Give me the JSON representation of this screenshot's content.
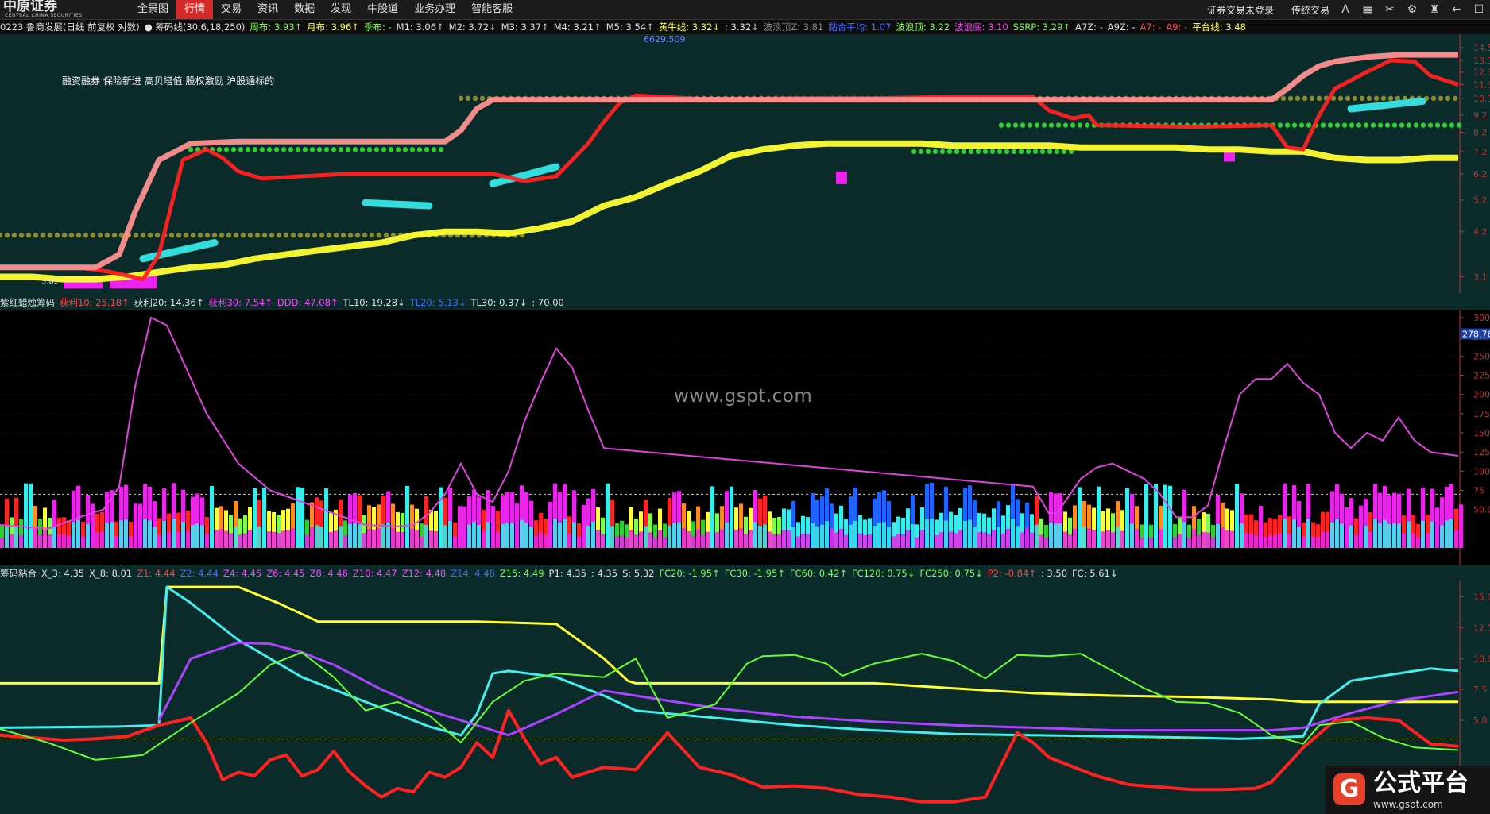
{
  "app": {
    "logo_text": "中原证券",
    "logo_sub": "CENTRAL CHINA SECURITIES",
    "menu": [
      "全景图",
      "行情",
      "交易",
      "资讯",
      "数据",
      "发现",
      "牛股道",
      "业务办理",
      "智能客服"
    ],
    "active_menu": "行情",
    "right_menu": [
      "证券交易未登录",
      "传统交易"
    ],
    "icons": [
      "font-size-icon",
      "grid-icon",
      "tools-icon",
      "gear-icon",
      "shirt-icon",
      "back-arrow-icon",
      "chat-icon"
    ]
  },
  "panel1": {
    "legend": [
      {
        "text": "0223 鲁商发展(日线 前复权 对数)",
        "color": "#e0e0e0"
      },
      {
        "text": "● 筹码线(30,6,18,250)",
        "color": "#e0e0e0"
      },
      {
        "text": "周布: 3.93↑",
        "color": "#7cff4c"
      },
      {
        "text": "月布: 3.96↑",
        "color": "#ffff44"
      },
      {
        "text": "季布: -",
        "color": "#7cff4c"
      },
      {
        "text": "M1: 3.06↑",
        "color": "#e0e0e0"
      },
      {
        "text": "M2: 3.72↓",
        "color": "#e0e0e0"
      },
      {
        "text": "M3: 3.37↑",
        "color": "#e0e0e0"
      },
      {
        "text": "M4: 3.21↑",
        "color": "#e0e0e0"
      },
      {
        "text": "M5: 3.54↑",
        "color": "#e0e0e0"
      },
      {
        "text": "黄牛线: 3.32↓",
        "color": "#ffff44"
      },
      {
        "text": ": 3.32↓",
        "color": "#e0e0e0"
      },
      {
        "text": "波浪顶Z: 3.81",
        "color": "#8a8a8a"
      },
      {
        "text": "黏合平均: 1.07",
        "color": "#4a6bff"
      },
      {
        "text": "波浪顶: 3.22",
        "color": "#7cff4c"
      },
      {
        "text": "波浪底: 3.10",
        "color": "#ff44ff"
      },
      {
        "text": "SSRP: 3.29↑",
        "color": "#7cff4c"
      },
      {
        "text": "A7Z: -",
        "color": "#e0e0e0"
      },
      {
        "text": "A9Z: -",
        "color": "#e0e0e0"
      },
      {
        "text": "A7: -",
        "color": "#ff4444"
      },
      {
        "text": "A9: -",
        "color": "#ff4444"
      },
      {
        "text": "平台线: 3.48",
        "color": "#ffff44"
      }
    ],
    "annotation": "融资融券 保险新进 高贝塔值 股权激励 沪股通标的",
    "peak_label": "6629.509",
    "price_label": "3.02",
    "chart_data": {
      "type": "line",
      "scale": "log",
      "y_ticks": [
        "14.5",
        "13.3",
        "12.3",
        "11.3",
        "10.3",
        "9.2",
        "8.2",
        "7.2",
        "6.2",
        "5.2",
        "4.2",
        "3.1"
      ],
      "series": [
        {
          "color": "#ffff33",
          "x": [
            0,
            40,
            80,
            120,
            160,
            200,
            240,
            280,
            320,
            360,
            400,
            440,
            480,
            520,
            560,
            600,
            640,
            680,
            720,
            760,
            800,
            840,
            880,
            920,
            960,
            1000,
            1040,
            1080,
            1120,
            1160,
            1200,
            1240,
            1280,
            1320,
            1360,
            1400,
            1440,
            1480,
            1520,
            1560,
            1600,
            1640,
            1680,
            1720,
            1760,
            1800,
            1835
          ],
          "y": [
            3.1,
            3.1,
            3.05,
            3.05,
            3.1,
            3.2,
            3.3,
            3.35,
            3.5,
            3.6,
            3.7,
            3.8,
            3.9,
            4.1,
            4.2,
            4.2,
            4.15,
            4.3,
            4.5,
            5.0,
            5.3,
            5.8,
            6.3,
            7.0,
            7.3,
            7.5,
            7.6,
            7.6,
            7.6,
            7.6,
            7.5,
            7.5,
            7.5,
            7.5,
            7.4,
            7.4,
            7.4,
            7.4,
            7.3,
            7.3,
            7.2,
            7.2,
            6.9,
            6.8,
            6.8,
            6.9,
            6.9
          ]
        },
        {
          "color": "#ff2222",
          "x": [
            100,
            140,
            180,
            200,
            230,
            260,
            280,
            300,
            330,
            380,
            440,
            500,
            540,
            580,
            620,
            660,
            700,
            720,
            740,
            760,
            780,
            800,
            900,
            1000,
            1100,
            1200,
            1300,
            1320,
            1350,
            1370,
            1380,
            1500,
            1600,
            1620,
            1640,
            1660,
            1680,
            1720,
            1750,
            1780,
            1800,
            1835
          ],
          "y": [
            3.3,
            3.2,
            3.05,
            3.6,
            6.8,
            7.3,
            6.9,
            6.3,
            6.0,
            6.1,
            6.2,
            6.2,
            6.2,
            6.2,
            6.2,
            5.9,
            6.1,
            6.8,
            7.6,
            8.8,
            10.0,
            10.5,
            10.2,
            10.3,
            10.3,
            10.4,
            10.4,
            9.5,
            9.0,
            9.2,
            8.6,
            8.5,
            8.6,
            7.4,
            7.3,
            9.2,
            11.0,
            12.3,
            13.3,
            13.2,
            12.0,
            11.3
          ]
        },
        {
          "color": "#ff9090",
          "x": [
            0,
            60,
            120,
            150,
            170,
            200,
            240,
            300,
            400,
            500,
            560,
            580,
            600,
            620,
            700,
            720,
            760,
            900,
            1100,
            1300,
            1400,
            1500,
            1600,
            1620,
            1640,
            1660,
            1680,
            1720,
            1760,
            1835
          ],
          "y": [
            3.3,
            3.3,
            3.3,
            3.6,
            4.8,
            6.8,
            7.6,
            7.7,
            7.7,
            7.7,
            7.7,
            8.3,
            9.6,
            10.2,
            10.2,
            10.2,
            10.2,
            10.2,
            10.2,
            10.2,
            10.2,
            10.2,
            10.2,
            11.0,
            12.0,
            12.8,
            13.2,
            13.6,
            13.8,
            13.8
          ]
        }
      ]
    }
  },
  "panel2": {
    "legend": [
      {
        "text": "紫红蜡烛筹码",
        "color": "#e0e0e0"
      },
      {
        "text": "获利10: 25.18↑",
        "color": "#ff4444"
      },
      {
        "text": "获利20: 14.36↑",
        "color": "#e0e0e0"
      },
      {
        "text": "获利30: 7.54↑",
        "color": "#ff44ff"
      },
      {
        "text": "DDD: 47.08↑",
        "color": "#ff44ff"
      },
      {
        "text": "TL10: 19.28↓",
        "color": "#e0e0e0"
      },
      {
        "text": "TL20: 5.13↓",
        "color": "#4a6bff"
      },
      {
        "text": "TL30: 0.37↓",
        "color": "#e0e0e0"
      },
      {
        "text": ": 70.00",
        "color": "#e0e0e0"
      }
    ],
    "watermark": "www.gspt.com",
    "current_value": "278.76",
    "chart_data": {
      "type": "bar",
      "y_ticks": [
        "300",
        "275",
        "250",
        "225",
        "200",
        "175",
        "150",
        "125",
        "100",
        "75",
        "50.00"
      ],
      "ylim": [
        0,
        300
      ],
      "reference_line": 70,
      "series": [
        {
          "name": "",
          "color": "#dd44dd",
          "x": [
            0,
            60,
            100,
            130,
            150,
            170,
            190,
            210,
            260,
            300,
            340,
            380,
            420,
            460,
            500,
            520,
            540,
            560,
            580,
            600,
            620,
            640,
            660,
            680,
            700,
            720,
            740,
            760,
            1300,
            1320,
            1330,
            1340,
            1360,
            1380,
            1400,
            1420,
            1440,
            1460,
            1480,
            1500,
            1520,
            1540,
            1560,
            1580,
            1600,
            1620,
            1640,
            1660,
            1680,
            1700,
            1720,
            1740,
            1760,
            1780,
            1800,
            1835
          ],
          "y": [
            30,
            25,
            40,
            50,
            80,
            210,
            300,
            290,
            175,
            110,
            75,
            60,
            45,
            30,
            28,
            30,
            45,
            70,
            110,
            70,
            60,
            100,
            165,
            215,
            260,
            235,
            180,
            130,
            80,
            45,
            45,
            60,
            90,
            105,
            110,
            100,
            90,
            70,
            40,
            40,
            55,
            130,
            200,
            220,
            220,
            240,
            215,
            200,
            150,
            130,
            150,
            140,
            170,
            140,
            125,
            120
          ]
        }
      ]
    }
  },
  "panel3": {
    "legend": [
      {
        "text": "筹码粘合",
        "color": "#e0e0e0"
      },
      {
        "text": "X_3: 4.35",
        "color": "#e0e0e0"
      },
      {
        "text": "X_8: 8.01",
        "color": "#e0e0e0"
      },
      {
        "text": "Z1: 4.44",
        "color": "#ff4444"
      },
      {
        "text": "Z2: 4.44",
        "color": "#4a6bff"
      },
      {
        "text": "Z4: 4.45",
        "color": "#ff44ff"
      },
      {
        "text": "Z6: 4.45",
        "color": "#ff44ff"
      },
      {
        "text": "Z8: 4.46",
        "color": "#ff44ff"
      },
      {
        "text": "Z10: 4.47",
        "color": "#ff44ff"
      },
      {
        "text": "Z12: 4.48",
        "color": "#ff44ff"
      },
      {
        "text": "Z14: 4.48",
        "color": "#4a6bff"
      },
      {
        "text": "Z15: 4.49",
        "color": "#7cff4c"
      },
      {
        "text": "P1: 4.35",
        "color": "#e0e0e0"
      },
      {
        "text": ": 4.35",
        "color": "#e0e0e0"
      },
      {
        "text": "S: 5.32",
        "color": "#e0e0e0"
      },
      {
        "text": "FC20: -1.95↑",
        "color": "#7cff4c"
      },
      {
        "text": "FC30: -1.95↑",
        "color": "#7cff4c"
      },
      {
        "text": "FC60: 0.42↑",
        "color": "#7cff4c"
      },
      {
        "text": "FC120: 0.75↓",
        "color": "#7cff4c"
      },
      {
        "text": "FC250: 0.75↓",
        "color": "#7cff4c"
      },
      {
        "text": "P2: -0.84↑",
        "color": "#ff4444"
      },
      {
        "text": ": 3.50",
        "color": "#e0e0e0"
      },
      {
        "text": "FC: 5.61↓",
        "color": "#e0e0e0"
      }
    ],
    "chart_data": {
      "type": "line",
      "y_ticks": [
        "15.0",
        "12.5",
        "10.0",
        "7.5",
        "5.0"
      ],
      "ylim": [
        -2,
        16
      ],
      "reference_line": 3.5,
      "series": [
        {
          "name": "",
          "color": "#ffff33",
          "x": [
            0,
            200,
            210,
            300,
            350,
            400,
            500,
            600,
            700,
            760,
            790,
            800,
            900,
            1100,
            1200,
            1300,
            1400,
            1500,
            1600,
            1640,
            1700,
            1800,
            1835
          ],
          "y": [
            8.0,
            8.0,
            15.8,
            15.8,
            14.5,
            13.0,
            13.0,
            13.0,
            12.8,
            10.0,
            8.2,
            8.0,
            8.0,
            8.0,
            7.6,
            7.2,
            7.0,
            6.9,
            6.7,
            6.5,
            6.5,
            6.5,
            6.5
          ]
        },
        {
          "name": "",
          "color": "#44eeee",
          "x": [
            0,
            150,
            200,
            210,
            240,
            300,
            380,
            460,
            540,
            580,
            600,
            620,
            640,
            700,
            760,
            800,
            900,
            1000,
            1100,
            1200,
            1300,
            1400,
            1500,
            1560,
            1600,
            1640,
            1660,
            1700,
            1760,
            1800,
            1835
          ],
          "y": [
            4.4,
            4.5,
            4.6,
            15.8,
            14.5,
            11.5,
            8.5,
            6.5,
            4.5,
            3.8,
            5.5,
            8.8,
            9.0,
            8.5,
            7.0,
            5.8,
            5.2,
            4.6,
            4.2,
            3.9,
            3.8,
            3.7,
            3.6,
            3.5,
            3.6,
            3.7,
            6.3,
            8.2,
            8.8,
            9.2,
            9.0
          ]
        },
        {
          "name": "",
          "color": "#ff2222",
          "x": [
            0,
            40,
            80,
            120,
            160,
            200,
            240,
            260,
            280,
            300,
            320,
            340,
            360,
            380,
            400,
            420,
            440,
            460,
            480,
            500,
            520,
            540,
            560,
            580,
            600,
            620,
            640,
            660,
            680,
            700,
            720,
            760,
            800,
            840,
            880,
            920,
            960,
            1000,
            1040,
            1080,
            1120,
            1160,
            1200,
            1240,
            1280,
            1300,
            1320,
            1340,
            1380,
            1420,
            1460,
            1500,
            1540,
            1580,
            1600,
            1640,
            1680,
            1720,
            1760,
            1800,
            1835
          ],
          "y": [
            3.8,
            3.6,
            3.4,
            3.5,
            3.7,
            4.6,
            5.2,
            3.2,
            0.2,
            0.8,
            0.5,
            1.8,
            2.2,
            0.5,
            1.0,
            2.5,
            0.8,
            -0.3,
            -1.2,
            -0.5,
            -0.8,
            0.8,
            0.4,
            1.2,
            3.2,
            2.0,
            5.8,
            3.5,
            1.5,
            2.0,
            0.4,
            1.2,
            1.0,
            4.0,
            1.2,
            0.6,
            -0.4,
            -0.3,
            -0.5,
            -1.0,
            -1.2,
            -1.6,
            -1.6,
            -1.2,
            4.0,
            3.2,
            2.0,
            1.5,
            0.5,
            -0.2,
            -0.4,
            -0.6,
            -0.6,
            -0.5,
            0.0,
            2.8,
            5.0,
            5.2,
            5.0,
            3.1,
            2.9
          ]
        },
        {
          "name": "",
          "color": "#aa44ff",
          "x": [
            200,
            240,
            300,
            340,
            380,
            420,
            480,
            540,
            600,
            640,
            700,
            760,
            800,
            900,
            1000,
            1100,
            1200,
            1300,
            1400,
            1500,
            1600,
            1640,
            1700,
            1760,
            1835
          ],
          "y": [
            5.0,
            10.0,
            11.3,
            11.2,
            10.5,
            9.5,
            7.5,
            5.8,
            4.6,
            3.8,
            5.5,
            7.4,
            7.0,
            6.0,
            5.3,
            4.9,
            4.6,
            4.4,
            4.2,
            4.2,
            4.2,
            4.4,
            5.6,
            6.6,
            7.3
          ]
        },
        {
          "name": "",
          "color": "#66ff33",
          "x": [
            0,
            60,
            120,
            180,
            240,
            300,
            340,
            380,
            420,
            460,
            500,
            540,
            580,
            620,
            660,
            700,
            760,
            800,
            840,
            900,
            940,
            960,
            1000,
            1040,
            1060,
            1100,
            1160,
            1200,
            1240,
            1280,
            1320,
            1360,
            1400,
            1440,
            1480,
            1520,
            1560,
            1600,
            1640,
            1660,
            1700,
            1740,
            1780,
            1835
          ],
          "y": [
            4.3,
            3.2,
            1.8,
            2.2,
            4.8,
            7.2,
            9.5,
            10.5,
            8.5,
            5.8,
            6.5,
            5.4,
            3.2,
            6.5,
            8.2,
            8.8,
            8.5,
            10.0,
            5.2,
            6.3,
            9.6,
            10.2,
            10.3,
            9.6,
            8.6,
            9.6,
            10.4,
            9.8,
            8.4,
            10.3,
            10.2,
            10.4,
            9.0,
            7.6,
            6.5,
            6.4,
            5.6,
            3.8,
            3.1,
            4.6,
            4.9,
            3.6,
            2.8,
            2.6
          ]
        }
      ]
    }
  },
  "brand": {
    "icon": "G",
    "title": "公式平台",
    "url": "www.gspt.com"
  }
}
